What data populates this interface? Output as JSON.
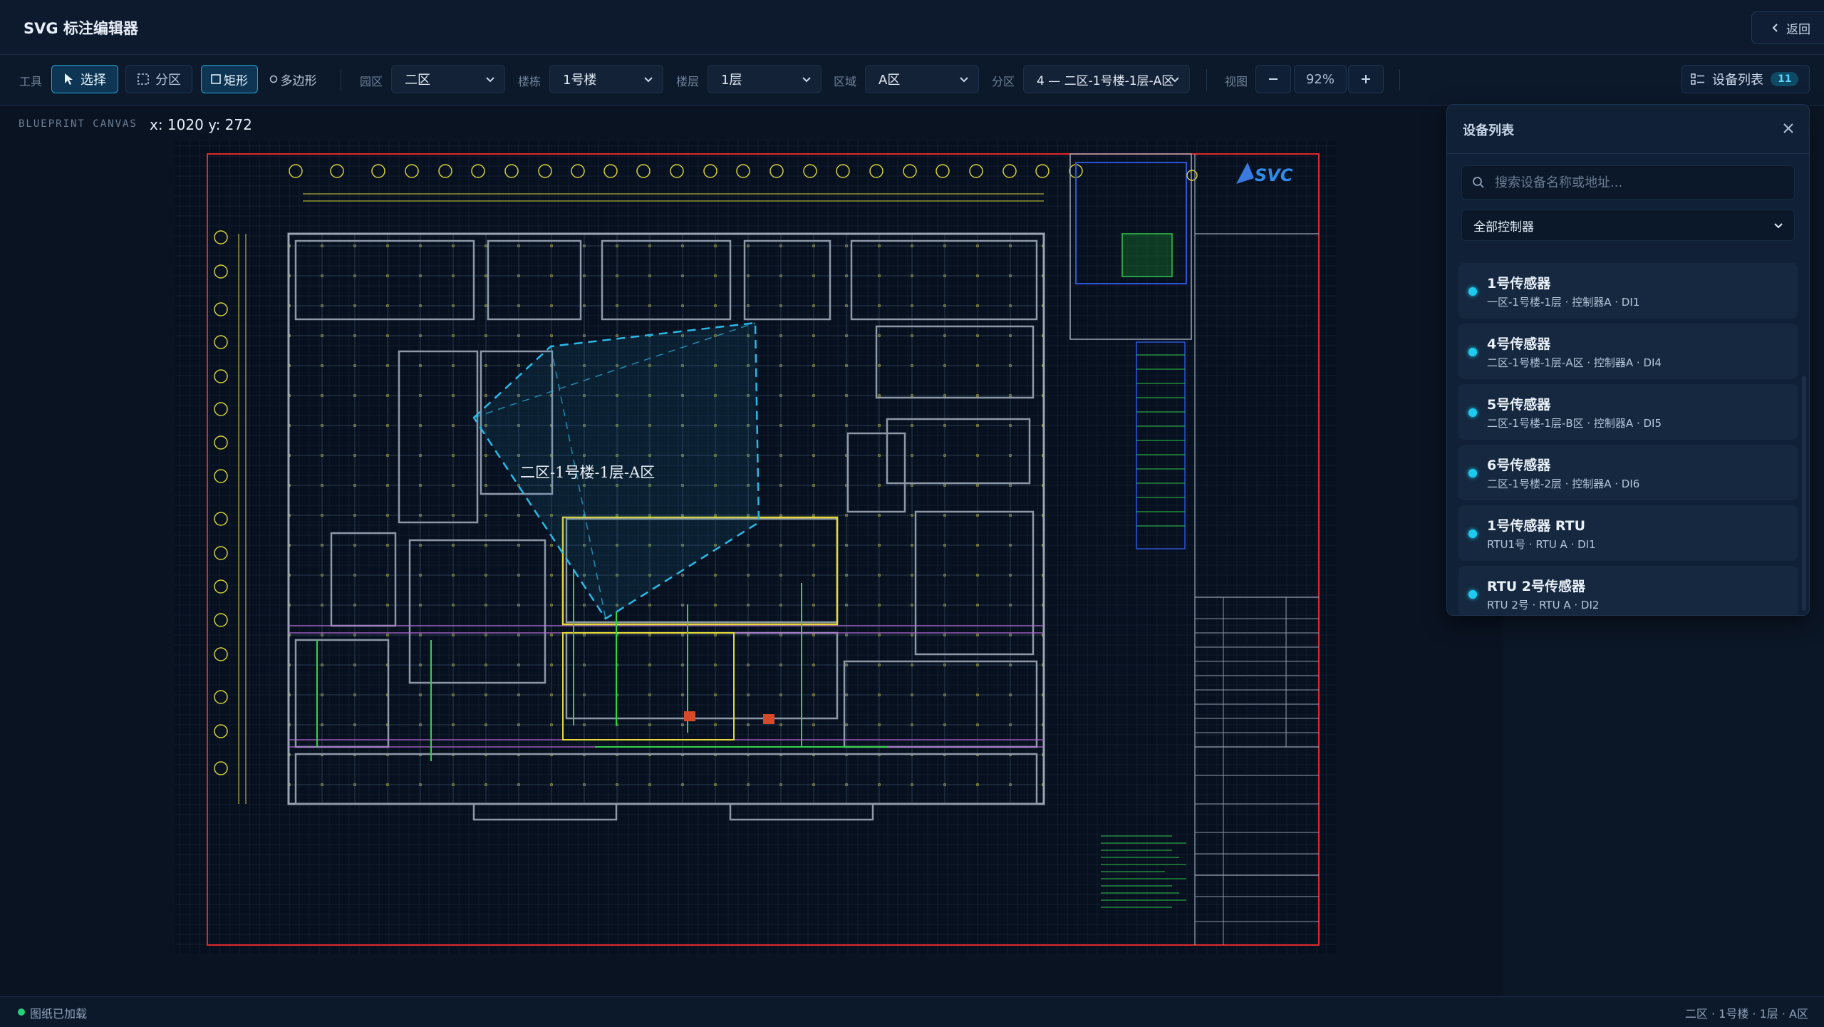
{
  "app": {
    "title": "SVG 标注编辑器",
    "back_label": "返回"
  },
  "toolbar": {
    "tools_label": "工具",
    "select_label": "选择",
    "partition_label": "分区",
    "rect_label": "矩形",
    "polygon_label": "多边形",
    "park_label": "园区",
    "park_value": "二区",
    "building_label": "楼栋",
    "building_value": "1号楼",
    "floor_label": "楼层",
    "floor_value": "1层",
    "region_label": "区域",
    "region_value": "A区",
    "subzone_label": "分区",
    "subzone_value": "4 — 二区-1号楼-1层-A区",
    "view_label": "视图",
    "zoom_value": "92%",
    "device_list_label": "设备列表",
    "device_count": "11"
  },
  "canvas": {
    "label": "BLUEPRINT CANVAS",
    "coords": "x: 1020 y: 272",
    "zone_label": "二区-1号楼-1层-A区"
  },
  "panel": {
    "title": "设备列表",
    "search_placeholder": "搜索设备名称或地址...",
    "filter_value": "全部控制器",
    "items": [
      {
        "name": "1号传感器",
        "meta": "一区-1号楼-1层 · 控制器A · DI1"
      },
      {
        "name": "4号传感器",
        "meta": "二区-1号楼-1层-A区 · 控制器A · DI4"
      },
      {
        "name": "5号传感器",
        "meta": "二区-1号楼-1层-B区 · 控制器A · DI5"
      },
      {
        "name": "6号传感器",
        "meta": "二区-1号楼-2层 · 控制器A · DI6"
      },
      {
        "name": "1号传感器 RTU",
        "meta": "RTU1号 · RTU A · DI1"
      },
      {
        "name": "RTU 2号传感器",
        "meta": "RTU 2号 · RTU A · DI2"
      }
    ]
  },
  "status": {
    "loaded_text": "图纸已加载",
    "location": "二区 · 1号楼 · 1层 · A区"
  },
  "colors": {
    "accent": "#1fa6d6",
    "device_dot": "#1ecbf0",
    "status_ok": "#22d37a",
    "zone_line": "#2cb8e6"
  }
}
